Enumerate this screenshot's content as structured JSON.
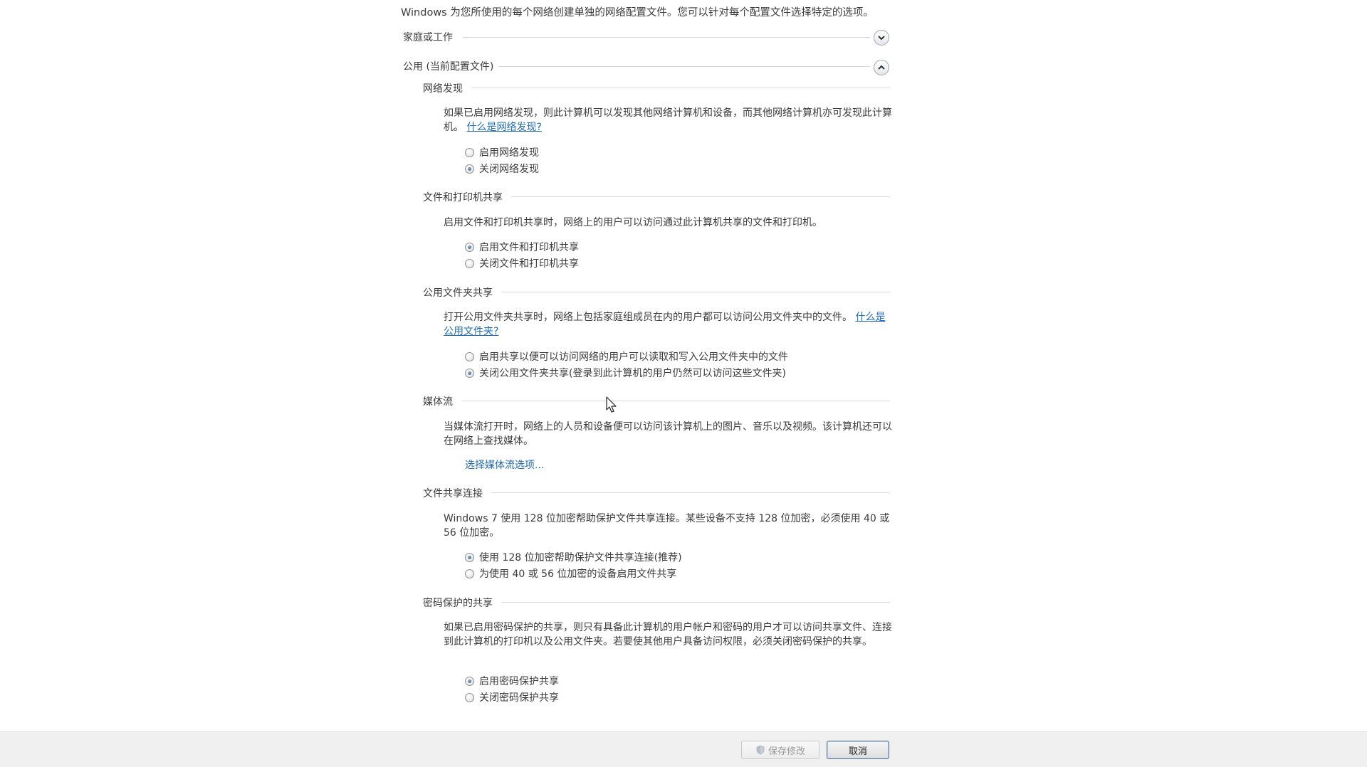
{
  "intro_text": "Windows 为您所使用的每个网络创建单独的网络配置文件。您可以针对每个配置文件选择特定的选项。",
  "profiles": {
    "home_work": {
      "label": "家庭或工作",
      "expanded": false
    },
    "public": {
      "label": "公用 (当前配置文件)",
      "expanded": true
    }
  },
  "sections": {
    "network_discovery": {
      "title": "网络发现",
      "description": "如果已启用网络发现，则此计算机可以发现其他网络计算机和设备，而其他网络计算机亦可发现此计算机。",
      "link": "什么是网络发现?",
      "options": [
        "启用网络发现",
        "关闭网络发现"
      ],
      "selected": 1
    },
    "file_printer_sharing": {
      "title": "文件和打印机共享",
      "description": "启用文件和打印机共享时，网络上的用户可以访问通过此计算机共享的文件和打印机。",
      "options": [
        "启用文件和打印机共享",
        "关闭文件和打印机共享"
      ],
      "selected": 0
    },
    "public_folder_sharing": {
      "title": "公用文件夹共享",
      "description": "打开公用文件夹共享时，网络上包括家庭组成员在内的用户都可以访问公用文件夹中的文件。",
      "link": "什么是公用文件夹?",
      "options": [
        "启用共享以便可以访问网络的用户可以读取和写入公用文件夹中的文件",
        "关闭公用文件夹共享(登录到此计算机的用户仍然可以访问这些文件夹)"
      ],
      "selected": 1
    },
    "media_streaming": {
      "title": "媒体流",
      "description": "当媒体流打开时，网络上的人员和设备便可以访问该计算机上的图片、音乐以及视频。该计算机还可以在网络上查找媒体。",
      "link": "选择媒体流选项..."
    },
    "file_sharing_connections": {
      "title": "文件共享连接",
      "description": "Windows 7 使用 128 位加密帮助保护文件共享连接。某些设备不支持 128 位加密，必须使用 40 或 56 位加密。",
      "options": [
        "使用 128 位加密帮助保护文件共享连接(推荐)",
        "为使用 40 或 56 位加密的设备启用文件共享"
      ],
      "selected": 0
    },
    "password_protected_sharing": {
      "title": "密码保护的共享",
      "description": "如果已启用密码保护的共享，则只有具备此计算机的用户帐户和密码的用户才可以访问共享文件、连接到此计算机的打印机以及公用文件夹。若要使其他用户具备访问权限，必须关闭密码保护的共享。",
      "options": [
        "启用密码保护共享",
        "关闭密码保护共享"
      ],
      "selected": 0
    }
  },
  "buttons": {
    "save": "保存修改",
    "cancel": "取消"
  },
  "colors": {
    "link": "#1f6bb5",
    "bottom_bar": "#f0f0f0"
  }
}
